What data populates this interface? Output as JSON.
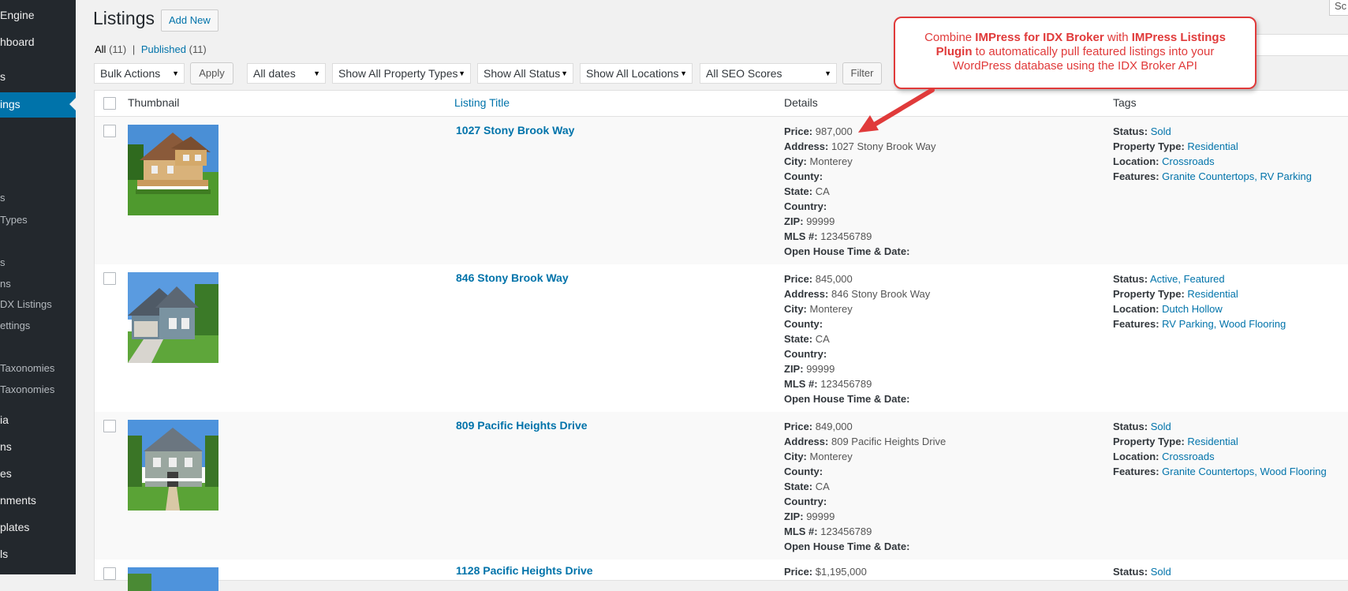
{
  "sidebar": {
    "items": [
      {
        "label": "Engine"
      },
      {
        "label": "hboard"
      },
      {
        "label": "s"
      },
      {
        "label": "ings"
      },
      {
        "label": ""
      },
      {
        "label": "s"
      },
      {
        "label": "Types"
      },
      {
        "label": "s"
      },
      {
        "label": "ns"
      },
      {
        "label": "DX Listings"
      },
      {
        "label": "ettings"
      },
      {
        "label": "Taxonomies"
      },
      {
        "label": "Taxonomies"
      },
      {
        "label": "ia"
      },
      {
        "label": "ns"
      },
      {
        "label": "es"
      },
      {
        "label": "nments"
      },
      {
        "label": "plates"
      },
      {
        "label": "ls"
      }
    ]
  },
  "header": {
    "title": "Listings",
    "add_new": "Add New",
    "screen_options": "Sc"
  },
  "filters": {
    "all_label": "All",
    "all_count": "(11)",
    "sep": "|",
    "published_label": "Published",
    "published_count": "(11)"
  },
  "tablenav": {
    "bulk_actions": "Bulk Actions",
    "apply": "Apply",
    "dates": "All dates",
    "property_types": "Show All Property Types",
    "status": "Show All Status",
    "locations": "Show All Locations",
    "seo_scores": "All SEO Scores",
    "filter": "Filter"
  },
  "table": {
    "columns": {
      "thumbnail": "Thumbnail",
      "listing_title": "Listing Title",
      "details": "Details",
      "tags": "Tags"
    },
    "detail_labels": {
      "price": "Price:",
      "address": "Address:",
      "city": "City:",
      "county": "County:",
      "state": "State:",
      "country": "Country:",
      "zip": "ZIP:",
      "mls": "MLS #:",
      "open_house": "Open House Time & Date:"
    },
    "tag_labels": {
      "status": "Status:",
      "property_type": "Property Type:",
      "location": "Location:",
      "features": "Features:"
    },
    "rows": [
      {
        "title": "1027 Stony Brook Way",
        "price": "987,000",
        "address": "1027 Stony Brook Way",
        "city": "Monterey",
        "state": "CA",
        "zip": "99999",
        "mls": "123456789",
        "status": "Sold",
        "property_type": "Residential",
        "location": "Crossroads",
        "features": "Granite Countertops, RV Parking"
      },
      {
        "title": "846 Stony Brook Way",
        "price": "845,000",
        "address": "846 Stony Brook Way",
        "city": "Monterey",
        "state": "CA",
        "zip": "99999",
        "mls": "123456789",
        "status": "Active, Featured",
        "property_type": "Residential",
        "location": "Dutch Hollow",
        "features": "RV Parking, Wood Flooring"
      },
      {
        "title": "809 Pacific Heights Drive",
        "price": "849,000",
        "address": "809 Pacific Heights Drive",
        "city": "Monterey",
        "state": "CA",
        "zip": "99999",
        "mls": "123456789",
        "status": "Sold",
        "property_type": "Residential",
        "location": "Crossroads",
        "features": "Granite Countertops, Wood Flooring"
      },
      {
        "title": "1128 Pacific Heights Drive",
        "price": "$1,195,000",
        "status": "Sold"
      }
    ]
  },
  "callout": {
    "pre": "Combine ",
    "bold1": "IMPress for IDX Broker",
    "mid": " with ",
    "bold2": "IMPress Listings Plugin",
    "post": " to automatically pull featured listings into your WordPress database using the IDX Broker API"
  },
  "colors": {
    "sidebar_bg": "#23282d",
    "accent": "#0073aa",
    "callout_red": "#e03a3a"
  }
}
